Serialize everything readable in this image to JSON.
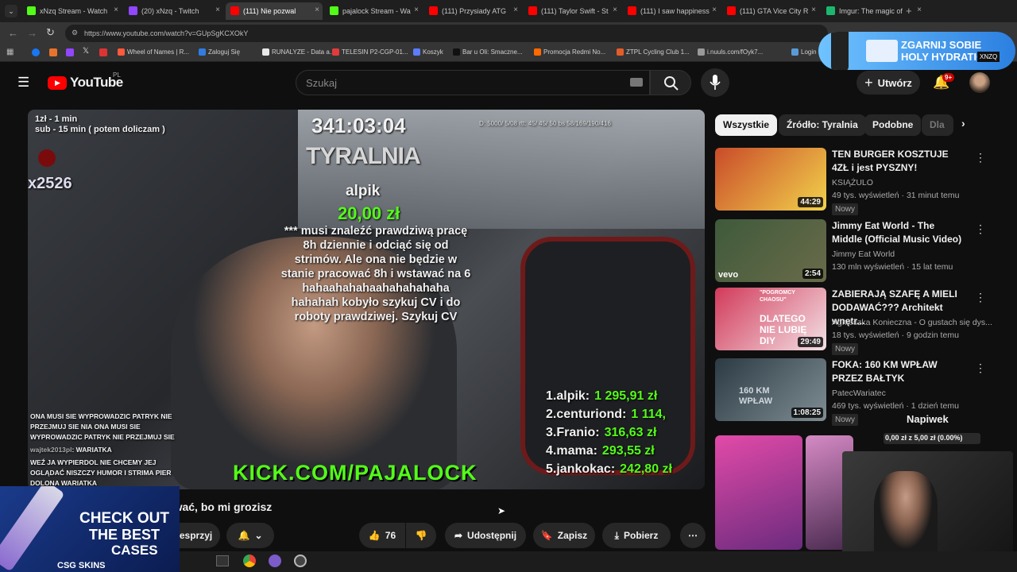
{
  "tabs": [
    {
      "label": "xNzq Stream - Watch",
      "color": "#53fc18"
    },
    {
      "label": "(20) xNzq - Twitch",
      "color": "#9146ff"
    },
    {
      "label": "(111) Nie pozwal",
      "color": "#ff0000"
    },
    {
      "label": "pajalock Stream - Wa",
      "color": "#53fc18"
    },
    {
      "label": "(111) Przysiady ATG",
      "color": "#ff0000"
    },
    {
      "label": "(111) Taylor Swift - St",
      "color": "#ff0000"
    },
    {
      "label": "(111) I saw happiness",
      "color": "#ff0000"
    },
    {
      "label": "(111) GTA Vice City R",
      "color": "#ff0000"
    },
    {
      "label": "Imgur: The magic of",
      "color": "#1bb76e"
    }
  ],
  "url": "https://www.youtube.com/watch?v=GUpSgKCXOkY",
  "bookmarks": [
    "Wheel of Names | R...",
    "Zaloguj Się",
    "RUNALYZE - Data a...",
    "TELESIN P2-CGP-01...",
    "Koszyk",
    "Bar u Oli: Smaczne...",
    "Promocja Redmi No...",
    "ZTPL Cycling Club 1...",
    "i.nuuls.com/fOyk7...",
    "Login"
  ],
  "ad_banner": {
    "line1": "ZGARNIJ SOBIE",
    "line2": "HOLY HYDRATION",
    "tag": "XNZQ"
  },
  "yt": {
    "logo": "YouTube",
    "region": "PL",
    "search_placeholder": "Szukaj",
    "create_label": "Utwórz",
    "notif_count": "9+"
  },
  "video": {
    "overlay_tl1": "1zł - 1 min",
    "overlay_tl2": "sub - 15 min ( potem doliczam )",
    "timer": "341:03:04",
    "stats": "D: 5000/ 5/08 rtt: 45/ 45/ 50 bs 58/169/190/416",
    "brand": "TYRALNIA",
    "id_tag": "x2526",
    "donor": "alpik",
    "amount": "20,00 zł",
    "message": "*** musi znaleźć prawdziwą pracę 8h dziennie i odciąć się od strimów. Ale ona nie będzie w stanie pracować 8h i wstawać na 6 hahaahahahaahahahahaha hahahah kobyło szykuj CV i do roboty prawdziwej. Szykuj CV",
    "leaderboard": [
      {
        "rank": "1.",
        "name": "alpik:",
        "amount": "1 295,91 zł"
      },
      {
        "rank": "2.",
        "name": "centuriond:",
        "amount": "1 114,"
      },
      {
        "rank": "3.",
        "name": "Franio:",
        "amount": "316,63 zł"
      },
      {
        "rank": "4.",
        "name": "mama:",
        "amount": "293,55 zł"
      },
      {
        "rank": "5.",
        "name": "jankokac:",
        "amount": "242,80 zł"
      }
    ],
    "chat1": "ONA MUSI SIE WYPROWADZIC PATRYK NIE PRZEJMUJ SIE NIA ONA MUSI SIE WYPROWADZIC PATRYK NIE PRZEJMUJ SIE",
    "chat2_user": "wajtek2013pl",
    "chat2_text": ": WARIATKA",
    "chat3": "WEŹ JA WYPIERDOL NIE CHCEMY JEJ OGLĄDAĆ NISZCZY HUMOR I STRIMA PIER DOLONA WARIATKA",
    "kick_url": "KICK.COM/PAJALOCK"
  },
  "video_title": "Nie pozwalasz mi z tobą zerwać, bo mi grozisz",
  "actions": {
    "support": "Wesprzyj",
    "likes": "76",
    "share": "Udostępnij",
    "save": "Zapisz",
    "download": "Pobierz"
  },
  "chips": [
    "Wszystkie",
    "Źródło: Tyralnia",
    "Podobne",
    "Dla"
  ],
  "recs": [
    {
      "title": "TEN BURGER KOSZTUJE 4ZŁ i jest PYSZNY!",
      "channel": "KSIĄŻULO",
      "meta": "49 tys. wyświetleń · 31 minut temu",
      "badge": "Nowy",
      "duration": "44:29",
      "c1": "#c94b2a",
      "c2": "#f2d24b"
    },
    {
      "title": "Jimmy Eat World - The Middle (Official Music Video)",
      "channel": "Jimmy Eat World",
      "meta": "130 mln wyświetleń · 15 lat temu",
      "badge": "",
      "duration": "2:54",
      "c1": "#3e5a3b",
      "c2": "#6a6b4a"
    },
    {
      "title": "ZABIERAJĄ SZAFĘ A MIELI DODAWAĆ??? Architekt wnętr...",
      "channel": "Agnieszka Konieczna - O gustach się dys...",
      "meta": "18 tys. wyświetleń · 9 godzin temu",
      "badge": "Nowy",
      "duration": "29:49",
      "c1": "#d23a5a",
      "c2": "#f3e1e5"
    },
    {
      "title": "FOKA: 160 KM WPŁAW PRZEZ BAŁTYK",
      "channel": "PatecWariatec",
      "meta": "469 tys. wyświetleń · 1 dzień temu",
      "badge": "Nowy",
      "duration": "1:08:25",
      "c1": "#2c3a44",
      "c2": "#7f8d93"
    }
  ],
  "thumb_texts": {
    "rec2": "vevo",
    "rec3": "DLATEGO NIE LUBIĘ DIY",
    "rec3_top": "\"POGROMCY CHAOSU\"",
    "rec4": "160 KM WPŁAW"
  },
  "napiwek": {
    "label": "Napiwek",
    "progress": "0,00 zł z 5,00 zł (0.00%)"
  },
  "promo": {
    "line1": "CHECK OUT",
    "line2": "THE BEST",
    "line3": "CASES",
    "brand": "CSG SKINS"
  }
}
